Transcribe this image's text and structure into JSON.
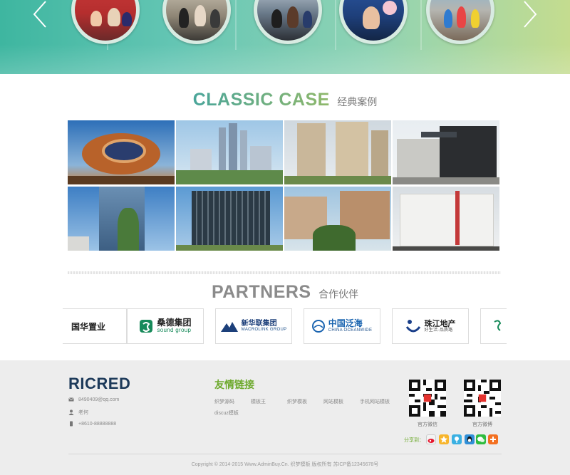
{
  "hero": {
    "thumbs": [
      "event-photo-1",
      "event-photo-2",
      "event-photo-3",
      "event-photo-4",
      "event-photo-5"
    ]
  },
  "classic": {
    "title_en": "CLASSIC CASE",
    "title_cn": "经典案例"
  },
  "partners": {
    "title_en": "PARTNERS",
    "title_cn": "合作伙伴",
    "logos": [
      {
        "name": "国华置业",
        "sub": ""
      },
      {
        "name": "桑德集团",
        "sub": "sound group"
      },
      {
        "name": "新华联集团",
        "sub": "MACROLINK GROUP"
      },
      {
        "name": "中国泛海",
        "sub": "CHINA OCEANWIDE"
      },
      {
        "name": "珠江地产",
        "sub": "好生活·品质路"
      }
    ]
  },
  "footer": {
    "brand_main": "RICRED",
    "email": "8490409@qq.com",
    "contact_name": "老何",
    "phone": "+8610-88888888",
    "links_title": "友情链接",
    "links": [
      "织梦源码",
      "模板王",
      "织梦模板",
      "网站模板",
      "手机网站模板",
      "discuz模板"
    ],
    "qr_wechat_label": "官方微信",
    "qr_weibo_label": "官方微博",
    "share_label": "分享到：",
    "copyright": "Copyright © 2014-2015 Www.AdminBuy.Cn. 织梦模板 版权所有  苏ICP备12345678号"
  },
  "colors": {
    "accent_green": "#6eaa2e",
    "teal": "#4aa59a",
    "navy": "#1d3a5a"
  }
}
